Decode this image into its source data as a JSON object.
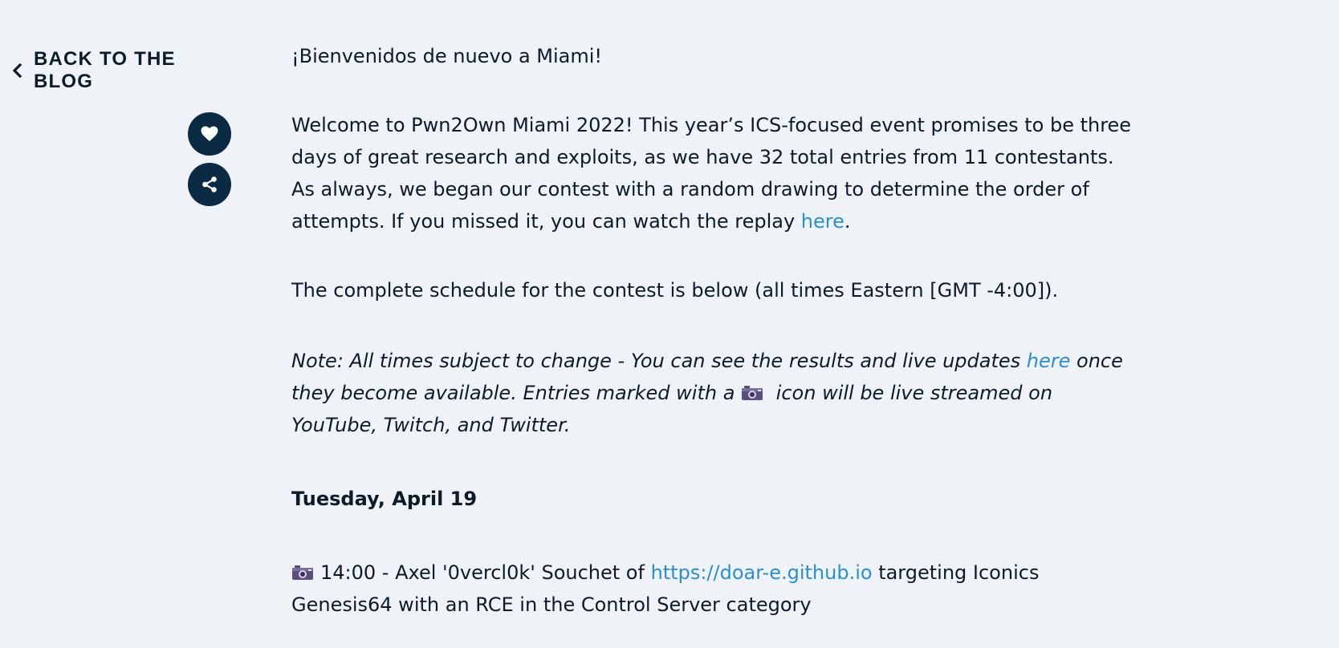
{
  "nav": {
    "back_label": "BACK TO THE BLOG"
  },
  "actions": {
    "like_icon": "heart-icon",
    "share_icon": "share-icon"
  },
  "article": {
    "greeting": "¡Bienvenidos de nuevo a Miami!",
    "welcome_text": "Welcome to Pwn2Own Miami 2022! This year’s ICS-focused event promises to be three days of great research and exploits, as we have 32 total entries from 11 contestants. As always, we began our contest with a random drawing to determine the order of attempts. If you missed it, you can watch the replay ",
    "welcome_link": "here",
    "welcome_end": ".",
    "schedule_text": "The complete schedule for the contest is below (all times Eastern [GMT -4:00]).",
    "note_start": "Note: All times subject to change - You can see the results and live updates ",
    "note_link": "here",
    "note_mid": " once they become available. Entries marked with a ",
    "note_end": " icon will be live streamed on YouTube, Twitch, and Twitter.",
    "day_heading": "Tuesday, April 19",
    "entry1_start": "14:00 - Axel '0vercl0k' Souchet of ",
    "entry1_link": "https://doar-e.github.io",
    "entry1_end": " targeting Iconics Genesis64 with an RCE in the Control Server category"
  },
  "colors": {
    "background": "#eff2f7",
    "text": "#0b1b2b",
    "link": "#2a8fd1",
    "button": "#0b2a44"
  }
}
